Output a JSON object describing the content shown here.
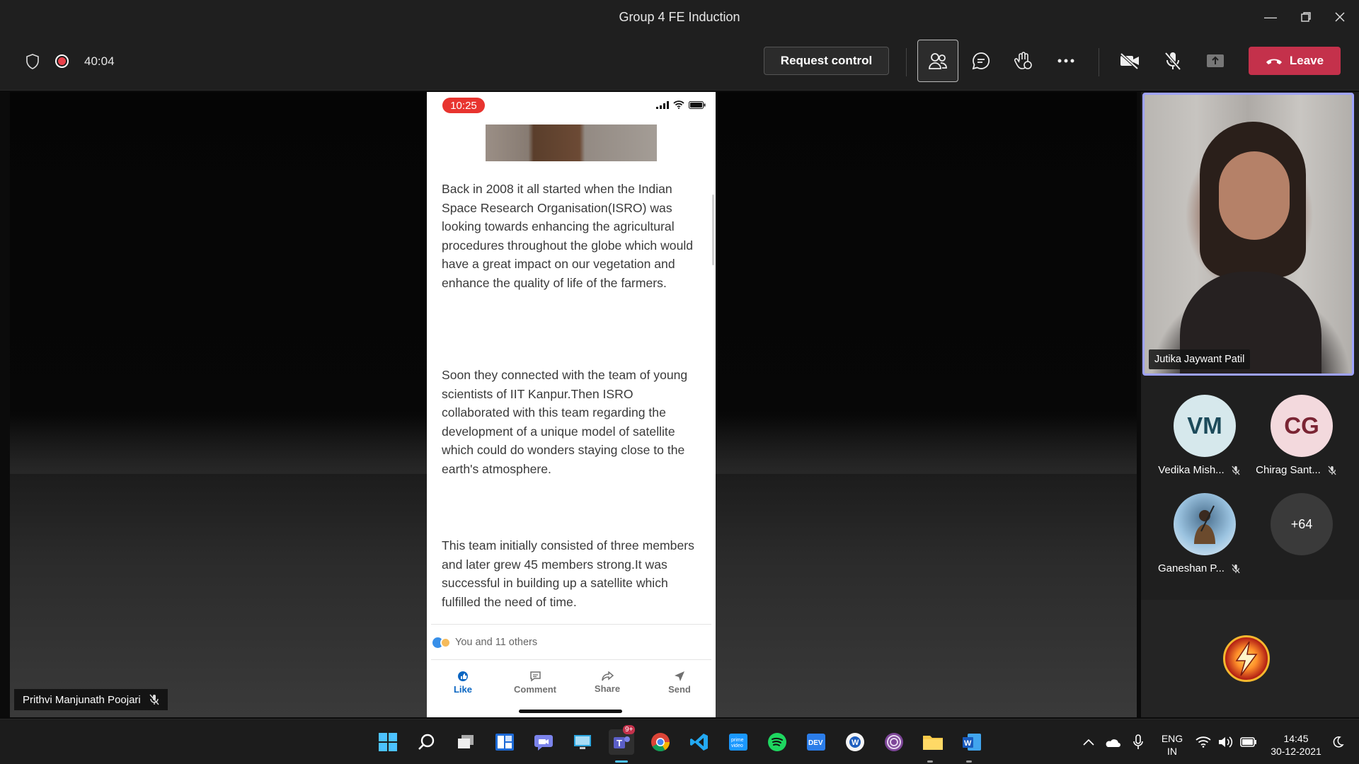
{
  "window": {
    "title": "Group 4 FE Induction",
    "controls": [
      "minimize-icon",
      "restore-icon",
      "close-icon"
    ]
  },
  "meeting": {
    "timer": "40:04",
    "request_control_label": "Request control",
    "leave_label": "Leave",
    "colors": {
      "leave": "#c4314b",
      "recording": "#e8414a",
      "highlight": "#9ea2ff"
    }
  },
  "shared_screen": {
    "presenter_name": "Prithvi Manjunath Poojari",
    "phone": {
      "clock": "10:25",
      "paragraphs": [
        "Back in 2008 it all started when the Indian Space Research Organisation(ISRO) was looking towards enhancing the agricultural procedures throughout the globe which would have a great impact on our vegetation and enhance the quality of life of the farmers.",
        "Soon they connected with the team of young scientists of IIT Kanpur.Then ISRO collaborated with this team regarding the development of a unique model of satellite which could do wonders staying close to the earth's atmosphere.",
        "This team initially consisted of three members and later grew 45 members strong.It was successful in building up a satellite which fulfilled the need of time."
      ],
      "reactions_text": "You and 11 others",
      "actions": [
        "Like",
        "Comment",
        "Share",
        "Send"
      ]
    }
  },
  "participants": {
    "speaker": {
      "name": "Jutika Jaywant Patil"
    },
    "tiles": [
      {
        "initials": "VM",
        "name": "Vedika Mish...",
        "bg": "#d6e8ec",
        "fg": "#1c4a5a"
      },
      {
        "initials": "CG",
        "name": "Chirag Sant...",
        "bg": "#f3d9dd",
        "fg": "#7a2433"
      },
      {
        "initials": "",
        "name": "Ganeshan P...",
        "bg": "#cfe3f2",
        "fg": "#000000"
      }
    ],
    "overflow_count": "+64"
  },
  "taskbar": {
    "apps": [
      "windows-start-icon",
      "search-icon",
      "task-view-icon",
      "widgets-icon",
      "chat-icon",
      "remote-desktop-icon",
      "teams-icon",
      "chrome-icon",
      "vscode-icon",
      "prime-video-icon",
      "spotify-icon",
      "dev-icon",
      "app-icon",
      "tor-browser-icon",
      "file-explorer-icon",
      "word-icon"
    ],
    "teams_badge": "9+",
    "lang_top": "ENG",
    "lang_bottom": "IN",
    "time": "14:45",
    "date": "30-12-2021"
  }
}
